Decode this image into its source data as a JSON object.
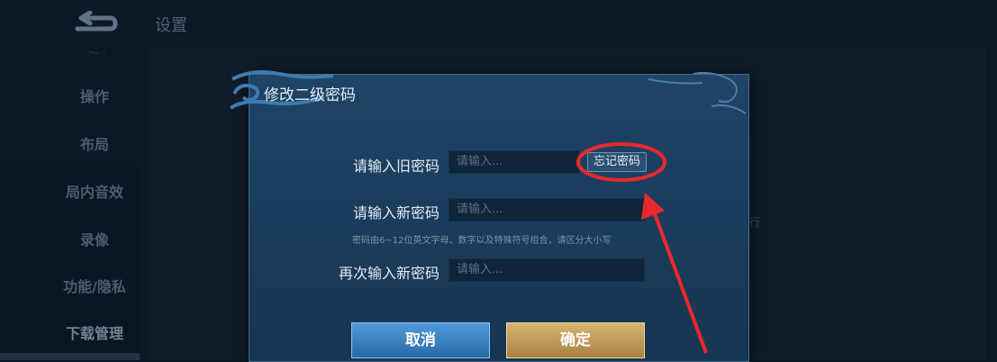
{
  "header": {
    "title": "设置",
    "back_icon": "back-arrow-icon"
  },
  "sidebar": {
    "top_partial": "～ ·",
    "items": [
      {
        "label": "操作"
      },
      {
        "label": "布局"
      },
      {
        "label": "局内音效"
      },
      {
        "label": "录像"
      },
      {
        "label": "功能/隐私"
      },
      {
        "label": "下载管理"
      }
    ]
  },
  "background": {
    "hint": "执行"
  },
  "modal": {
    "title": "修改二级密码",
    "fields": [
      {
        "label": "请输入旧密码",
        "placeholder": "请输入..."
      },
      {
        "label": "请输入新密码",
        "placeholder": "请输入..."
      },
      {
        "label": "再次输入新密码",
        "placeholder": "请输入..."
      }
    ],
    "forgot_label": "忘记密码",
    "hint": "密码由6~12位英文字母、数字以及特殊符号组合，请区分大小写",
    "cancel_label": "取消",
    "confirm_label": "确定"
  },
  "colors": {
    "annotation": "#e8292e",
    "confirm": "#c9a35e",
    "cancel": "#3d86c6"
  }
}
